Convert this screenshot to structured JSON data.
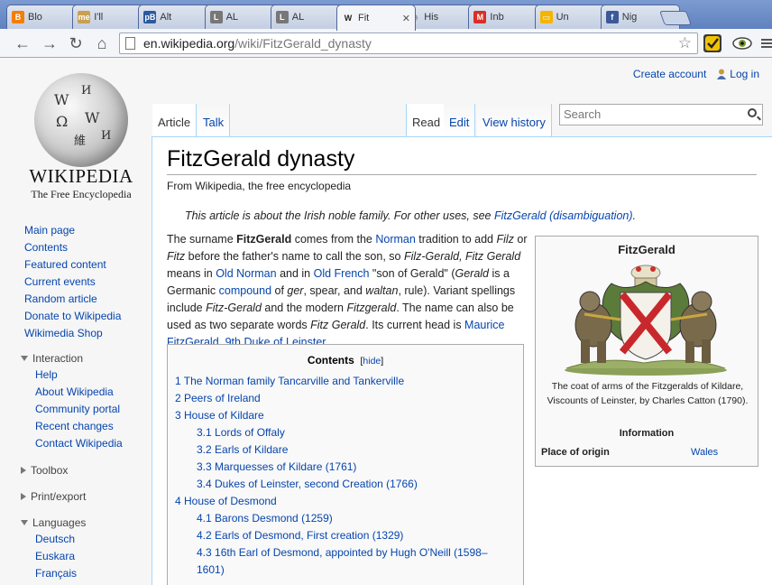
{
  "browser": {
    "tabs": [
      {
        "icon": "blogger-icon",
        "icon_color": "#f57d00",
        "label": "Blo"
      },
      {
        "icon": "me-icon",
        "icon_color": "#c8a050",
        "label": "I'll"
      },
      {
        "icon": "pb-icon",
        "icon_color": "#2c5aa0",
        "label": "Alt"
      },
      {
        "icon": "l-icon",
        "icon_color": "#777777",
        "label": "AL"
      },
      {
        "icon": "l-icon",
        "icon_color": "#777777",
        "label": "AL"
      },
      {
        "icon": "wikipedia-icon",
        "icon_color": "#222222",
        "label": "Fit"
      },
      {
        "icon": "clock-icon",
        "icon_color": "#555555",
        "label": "His"
      },
      {
        "icon": "gmail-icon",
        "icon_color": "#d93025",
        "label": "Inb"
      },
      {
        "icon": "slides-icon",
        "icon_color": "#f4b400",
        "label": "Un"
      },
      {
        "icon": "facebook-icon",
        "icon_color": "#3b5998",
        "label": "Nig"
      }
    ],
    "url_host": "en.wikipedia.org",
    "url_path": "/wiki/FitzGerald_dynasty"
  },
  "personal": {
    "create": "Create account",
    "login": "Log in"
  },
  "logo": {
    "wordmark": "WIKIPEDIA",
    "tagline": "The Free Encyclopedia"
  },
  "nav": [
    "Main page",
    "Contents",
    "Featured content",
    "Current events",
    "Random article",
    "Donate to Wikipedia",
    "Wikimedia Shop"
  ],
  "interaction": {
    "heading": "Interaction",
    "items": [
      "Help",
      "About Wikipedia",
      "Community portal",
      "Recent changes",
      "Contact Wikipedia"
    ]
  },
  "toolbox": "Toolbox",
  "printexport": "Print/export",
  "languages": {
    "heading": "Languages",
    "items": [
      "Deutsch",
      "Euskara",
      "Français"
    ]
  },
  "page_tabs": {
    "article": "Article",
    "talk": "Talk",
    "read": "Read",
    "edit": "Edit",
    "history": "View history"
  },
  "search": {
    "placeholder": "Search"
  },
  "article": {
    "title": "FitzGerald dynasty",
    "from": "From Wikipedia, the free encyclopedia",
    "hatnote_pre": "This article is about the Irish noble family. For other uses, see ",
    "hatnote_link": "FitzGerald (disambiguation)",
    "hatnote_post": "."
  },
  "intro": {
    "t1": "The surname ",
    "b1": "FitzGerald",
    "t2": " comes from the ",
    "l1": "Norman",
    "t3": " tradition to add ",
    "i1": "Filz",
    "t4": " or ",
    "i2": "Fitz",
    "t5": " before the father's name to call the son, so ",
    "i3": "Filz-Gerald, Fitz Gerald",
    "t6": " means in ",
    "l2": "Old Norman",
    "t7": " and in ",
    "l3": "Old French",
    "t8": " \"son of Gerald\" (",
    "i4": "Gerald",
    "t9": " is a Germanic ",
    "l4": "compound",
    "t10": " of ",
    "i5": "ger",
    "t11": ", spear, and ",
    "i6": "waltan",
    "t12": ", rule). Variant spellings include ",
    "i7": "Fitz-Gerald",
    "t13": " and the modern ",
    "i8": "Fitzgerald",
    "t14": ". The name can also be used as two separate words ",
    "i9": "Fitz Gerald",
    "t15": ". Its current head is ",
    "l5": "Maurice FitzGerald, 9th Duke of Leinster",
    "t16": "."
  },
  "infobox": {
    "title": "FitzGerald",
    "caption": "The coat of arms of the Fitzgeralds of Kildare, Viscounts of Leinster, by Charles Catton (1790).",
    "section": "Information",
    "label": "Place of origin",
    "value": "Wales"
  },
  "toc": {
    "title": "Contents",
    "hide_pre": "[",
    "hide": "hide",
    "hide_post": "]",
    "entries": [
      {
        "text": "1 The Norman family Tancarville and Tankerville",
        "level": 1
      },
      {
        "text": "2 Peers of Ireland",
        "level": 1
      },
      {
        "text": "3 House of Kildare",
        "level": 1
      },
      {
        "text": "3.1 Lords of Offaly",
        "level": 2
      },
      {
        "text": "3.2 Earls of Kildare",
        "level": 2
      },
      {
        "text": "3.3 Marquesses of Kildare (1761)",
        "level": 2
      },
      {
        "text": "3.4 Dukes of Leinster, second Creation (1766)",
        "level": 2
      },
      {
        "text": "4 House of Desmond",
        "level": 1
      },
      {
        "text": "4.1 Barons Desmond (1259)",
        "level": 2
      },
      {
        "text": "4.2 Earls of Desmond, First creation (1329)",
        "level": 2
      },
      {
        "text": "4.3 16th Earl of Desmond, appointed by Hugh O'Neill (1598–",
        "level": 2
      },
      {
        "text": "1601)",
        "level": 2
      }
    ]
  }
}
